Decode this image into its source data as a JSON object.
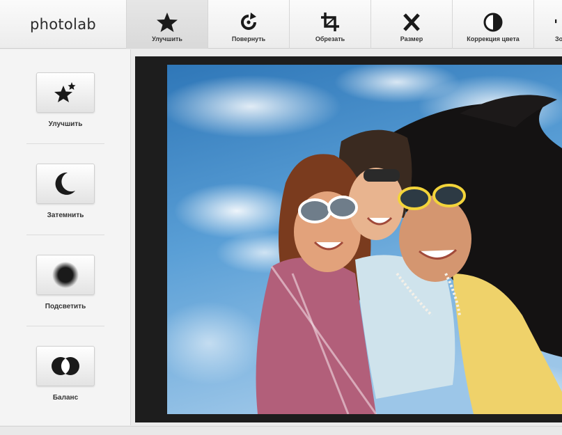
{
  "app": {
    "logo_text": "photolab"
  },
  "toolbar": {
    "items": [
      {
        "label": "Улучшить",
        "icon": "star-icon",
        "active": true
      },
      {
        "label": "Повернуть",
        "icon": "rotate-icon",
        "active": false
      },
      {
        "label": "Обрезать",
        "icon": "crop-icon",
        "active": false
      },
      {
        "label": "Размер",
        "icon": "resize-icon",
        "active": false
      },
      {
        "label": "Коррекция цвета",
        "icon": "contrast-icon",
        "active": false
      },
      {
        "label": "Зо",
        "icon": "partial-tool-icon",
        "active": false
      }
    ]
  },
  "sidebar": {
    "items": [
      {
        "label": "Улучшить",
        "icon": "sparkle-star-icon"
      },
      {
        "label": "Затемнить",
        "icon": "moon-icon"
      },
      {
        "label": "Подсветить",
        "icon": "blur-circle-icon"
      },
      {
        "label": "Баланс",
        "icon": "balance-circles-icon"
      }
    ]
  },
  "canvas": {
    "image_content": "photo-three-girls-sunglasses-sky"
  },
  "colors": {
    "toolbar_bg": "#f4f4f4",
    "active_tab_bg": "#dedede",
    "canvas_bg": "#1d1d1d",
    "icon": "#1a1a1a"
  }
}
